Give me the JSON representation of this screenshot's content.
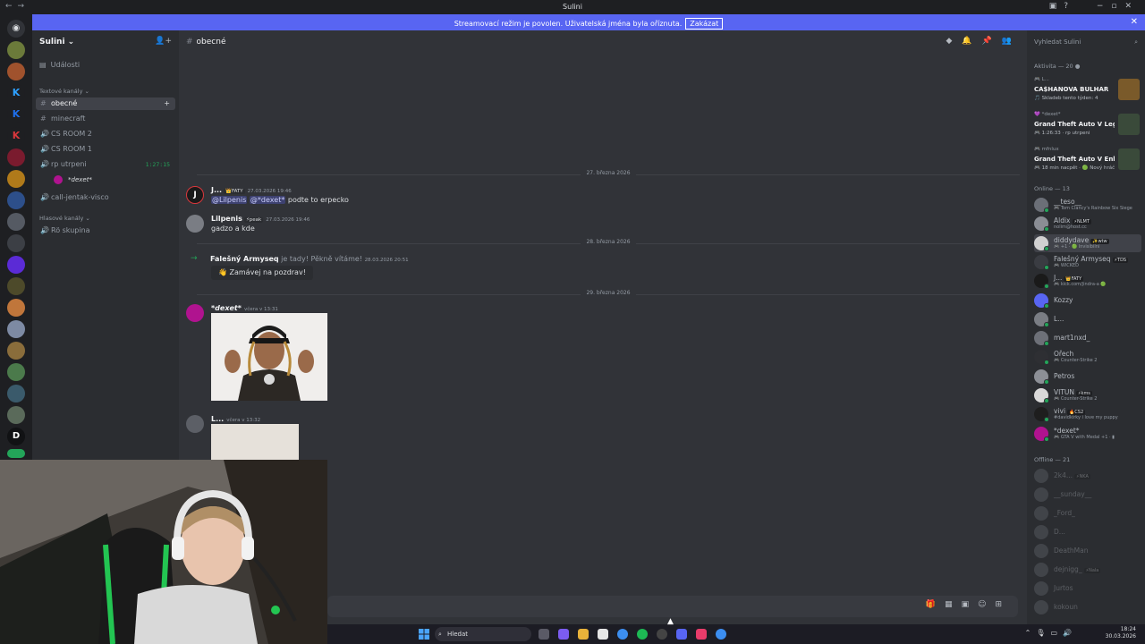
{
  "window": {
    "title": "Sulini",
    "nav_glyphs": "←→",
    "inbox_glyphs": "▣?",
    "controls_glyphs": "−▫✕"
  },
  "banner": {
    "text": "Streamovací režim je povolen. Uživatelská jména byla oříznuta.",
    "button": "Zakázat",
    "close_glyph": "✕"
  },
  "guild": {
    "name": "Sulini ⌄",
    "invite_glyph": "👤+",
    "events_label": "Události",
    "text_category": "Textové kanály ⌄",
    "voice_category": "Hlasové kanály ⌄",
    "channels": [
      {
        "icon": "#",
        "name": "obecné",
        "active": true,
        "extra": "+"
      },
      {
        "icon": "#",
        "name": "minecraft"
      },
      {
        "icon": "🔊",
        "name": "CS ROOM 2"
      },
      {
        "icon": "🔊",
        "name": "CS ROOM 1"
      },
      {
        "icon": "🔊",
        "name": "rp utrpeni",
        "timer": "1:27:15"
      },
      {
        "icon": "🔊",
        "name": "call-jentak-visco"
      },
      {
        "icon": "🔊",
        "name": "Rö skupina"
      }
    ],
    "voice_user": "*dexet*"
  },
  "chat": {
    "hash": "#",
    "channel": "obecné",
    "header_icons": "◆🔔📌👥",
    "dividers": [
      "27. března 2026",
      "28. března 2026",
      "29. března 2026"
    ],
    "messages": [
      {
        "author": "J...",
        "tag": "👑FATY",
        "time": "27.03.2026 19:46",
        "mention1": "@Lilpenis",
        "mention2": "@*dexet*",
        "text": " podte to erpecko"
      },
      {
        "author": "Lilpenis",
        "tag": "⚡peak",
        "time": "27.03.2026 19:46",
        "text": "gadzo a kde"
      },
      {
        "author": "*dexet*",
        "time": "včera v 13:31"
      },
      {
        "author": "L...",
        "time": "včera v 13:32"
      }
    ],
    "join": {
      "arrow": "→",
      "name": "Falešný Armyseq",
      "text": " je tady! Pěkně vítáme!",
      "time": "28.03.2026 20:51",
      "button": "👋 Zamávej na pozdrav!"
    },
    "input_icons": "🎁▦▣☺⊞"
  },
  "members": {
    "search_placeholder": "Vyhledat Sulini",
    "search_icon": "⌕",
    "activity_header": "Aktivita — 20 ●",
    "activities": [
      {
        "small": "🎮 L...",
        "game": "CA$HANOVA BULHAR",
        "sub": "🎵 Skladeb tento týden: 4"
      },
      {
        "small": "💜 *dexet*",
        "game": "Grand Theft Auto V Legacy",
        "sub": "🎮 1:26:33 · rp utrpeni"
      },
      {
        "small": "🎮 mfnlux",
        "game": "Grand Theft Auto V Enhan...",
        "sub": "🎮 18 min nacpět · 🟢 Nový hráč"
      }
    ],
    "online_header": "Online — 13",
    "online": [
      {
        "name": "__teso__",
        "status": "🎮 Tom Clancy's Rainbow Six Siege"
      },
      {
        "name": "Aldix",
        "tag": "⚡NLMT",
        "status": "nolim@host.cc"
      },
      {
        "name": "diddydave",
        "tag": "✨wtw",
        "status": "🎮 +1 · 🟢 Invisibilní"
      },
      {
        "name": "Falešný Armyseq",
        "tag": "⚡TDS",
        "status": "🎮 WICKED"
      },
      {
        "name": "J...",
        "tag": "👑FATY",
        "status": "🎮 kick.com/jindra-a 🟢"
      },
      {
        "name": "Kozzy"
      },
      {
        "name": "L..."
      },
      {
        "name": "mart1nxd_"
      },
      {
        "name": "Ořech",
        "status": "🎮 Counter-Strike 2"
      },
      {
        "name": "Petros"
      },
      {
        "name": "VITUN",
        "tag": "⚡kms",
        "status": "🎮 Counter-Strike 2"
      },
      {
        "name": "vivi",
        "tag": "🔥CS2",
        "status": "#davidkirky i love my puppy"
      },
      {
        "name": "*dexet*",
        "status": "🎮 GTA V with Medal +1 · ▮"
      }
    ],
    "offline_header": "Offline — 21",
    "offline": [
      {
        "name": "2k4...",
        "tag": "⚡NKA"
      },
      {
        "name": "__sunday__"
      },
      {
        "name": "_Ford_"
      },
      {
        "name": "D..."
      },
      {
        "name": "DeathMan"
      },
      {
        "name": "dejnigg_",
        "tag": "⚡Nala"
      },
      {
        "name": "Jurtos"
      },
      {
        "name": "kokoun"
      }
    ]
  },
  "taskbar": {
    "search_label": "Hledat",
    "search_icon": "⌕",
    "tray_glyphs": "⌃🎙▭🔊",
    "time": "18:24",
    "date": "30.03.2026"
  },
  "cursor_glyph": "▲"
}
